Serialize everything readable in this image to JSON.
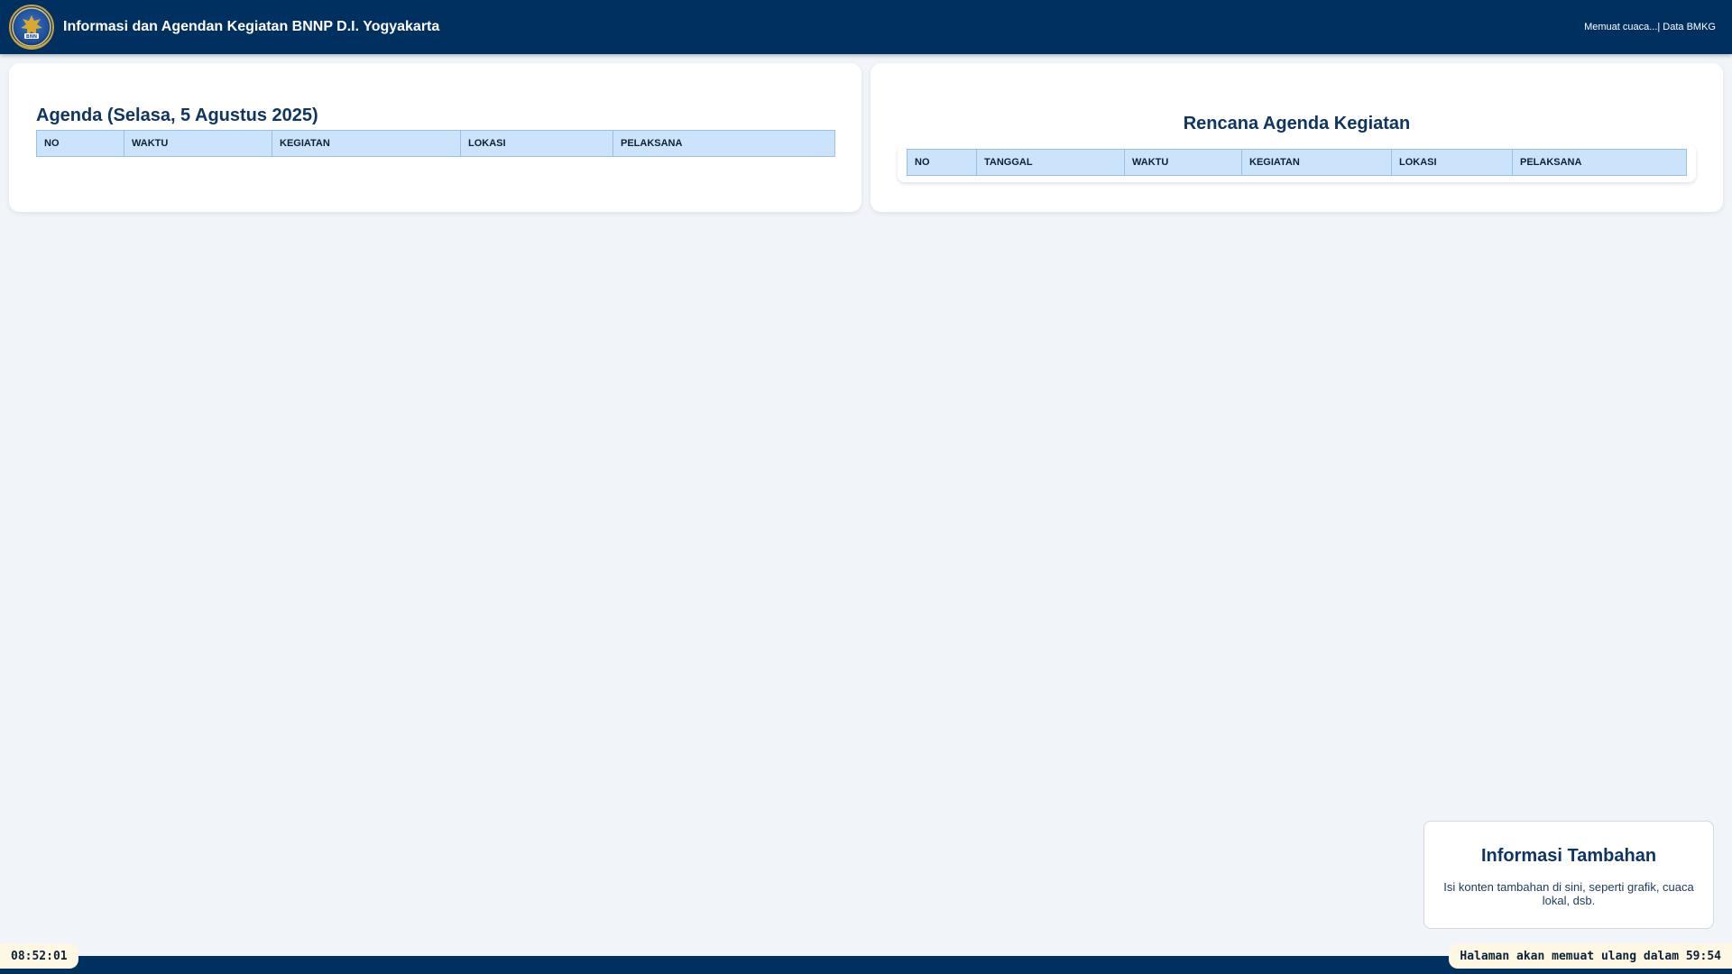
{
  "header": {
    "logo_icon": "bnn-emblem-icon",
    "title": "Informasi dan Agendan Kegiatan BNNP D.I. Yogyakarta",
    "weather": "Memuat cuaca...| Data BMKG"
  },
  "agenda_today": {
    "title": "Agenda (Selasa, 5 Agustus 2025)",
    "columns": [
      "NO",
      "WAKTU",
      "KEGIATAN",
      "LOKASI",
      "PELAKSANA"
    ]
  },
  "agenda_plan": {
    "title": "Rencana Agenda Kegiatan",
    "columns": [
      "NO",
      "TANGGAL",
      "WAKTU",
      "KEGIATAN",
      "LOKASI",
      "PELAKSANA"
    ]
  },
  "info": {
    "title": "Informasi Tambahan",
    "text": "Isi konten tambahan di sini, seperti grafik, cuaca lokal, dsb."
  },
  "footer": {
    "clock": "08:52:01",
    "reload": "Halaman akan memuat ulang dalam 59:54"
  },
  "colors": {
    "header_bg": "#00305f",
    "table_header_bg": "#cce4fb",
    "title_color": "#0f3563",
    "badge_bg": "#fdf7e3"
  }
}
